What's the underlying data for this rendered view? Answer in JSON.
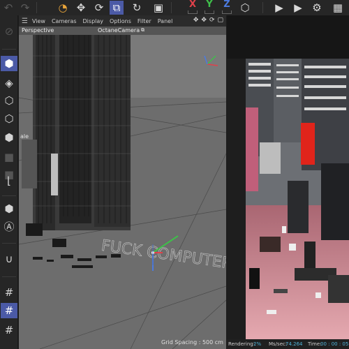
{
  "toolbar": {
    "axes": {
      "x": "X",
      "y": "Y",
      "z": "Z"
    }
  },
  "viewport": {
    "menu": {
      "view": "View",
      "cameras": "Cameras",
      "display": "Display",
      "options": "Options",
      "filter": "Filter",
      "panel": "Panel"
    },
    "camera_mode": "Perspective",
    "active_camera": "OctaneCamera",
    "scene_text": "FUCK COMPUTERS",
    "partial_label": "ale",
    "grid_spacing": "Grid Spacing : 500 cm"
  },
  "render_status": {
    "rendering_label": "Rendering:",
    "rendering_value": "2%",
    "ms_label": "Ms/sec:",
    "ms_value": "74.264",
    "time_label": "Time:",
    "time_value": "00 : 00 : 05"
  },
  "colors": {
    "accent": "#4b5aa6",
    "axis_x": "#e0414a",
    "axis_y": "#3fbf4a",
    "axis_z": "#4c7be0",
    "viewport_bg": "#6b6b6b",
    "render_pink": "#c78089"
  },
  "icons": {
    "top": [
      "undo-icon",
      "redo-icon",
      "model-mode-icon",
      "move-icon",
      "rotate-icon",
      "scale-icon",
      "select-icon",
      "refresh-icon",
      "coordinate-system-icon",
      "render-region-icon",
      "render-view-icon",
      "render-settings-icon"
    ],
    "left": [
      "make-editable-icon",
      "cube-icon",
      "object-mode-icon",
      "point-mode-icon",
      "edge-mode-icon",
      "polygon-mode-icon",
      "uv-mode-icon",
      "axis-icon",
      "solo-icon",
      "texture-icon",
      "magnet-icon",
      "grid-snap-icon",
      "workplane-icon",
      "snap-settings-icon"
    ]
  }
}
